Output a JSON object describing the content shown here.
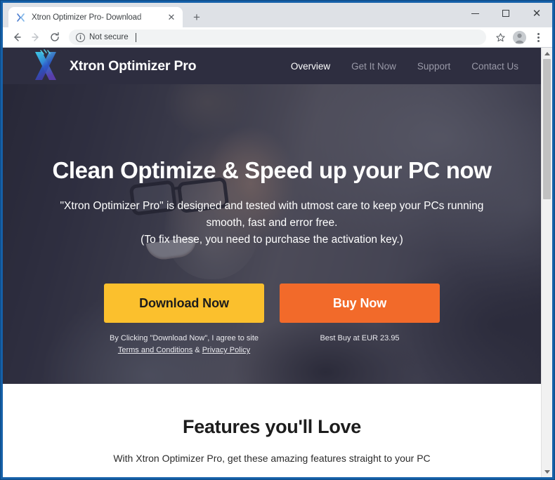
{
  "browser": {
    "tab": {
      "title": "Xtron Optimizer Pro- Download",
      "favicon_name": "xtron-favicon",
      "close_glyph": "✕"
    },
    "new_tab_glyph": "+",
    "window_controls": {
      "minimize": "minimize",
      "maximize": "maximize",
      "close": "✕"
    },
    "toolbar": {
      "back_glyph": "←",
      "forward_glyph": "→",
      "reload_glyph": "⟳",
      "security_label": "Not secure",
      "security_icon_glyph": "i",
      "url_value": "",
      "url_placeholder": "",
      "bookmark_glyph": "☆",
      "profile_name": "profile-avatar",
      "menu_name": "chrome-menu"
    },
    "scrollbar": {
      "up_arrow": "scroll-up",
      "down_arrow": "scroll-down"
    }
  },
  "site": {
    "brand": {
      "name": "Xtron Optimizer Pro",
      "logo_name": "xtron-x-logo",
      "logo_colors": {
        "cyan": "#31c9e8",
        "blue": "#2b58c8",
        "purple": "#5c3fb0"
      }
    },
    "nav": {
      "links": [
        {
          "label": "Overview",
          "active": true
        },
        {
          "label": "Get It Now",
          "active": false
        },
        {
          "label": "Support",
          "active": false
        },
        {
          "label": "Contact Us",
          "active": false
        }
      ]
    },
    "hero": {
      "title": "Clean Optimize & Speed up your PC now",
      "paragraph_lines": [
        "\"Xtron Optimizer Pro\" is designed and tested with utmost care to keep your PCs running",
        "smooth, fast and error free.",
        "(To fix these, you need to purchase the activation key.)"
      ],
      "download": {
        "button_label": "Download Now",
        "button_color": "#fbc02d",
        "note_prefix": "By Clicking \"Download Now\", I agree to site",
        "terms_label": "Terms and Conditions",
        "note_conjunction": "&",
        "privacy_label": "Privacy Policy"
      },
      "buy": {
        "button_label": "Buy Now",
        "button_color": "#f26a2a",
        "note": "Best Buy at EUR 23.95"
      }
    },
    "features": {
      "title": "Features you'll Love",
      "subtitle": "With Xtron Optimizer Pro, get these amazing features straight to your PC"
    }
  }
}
